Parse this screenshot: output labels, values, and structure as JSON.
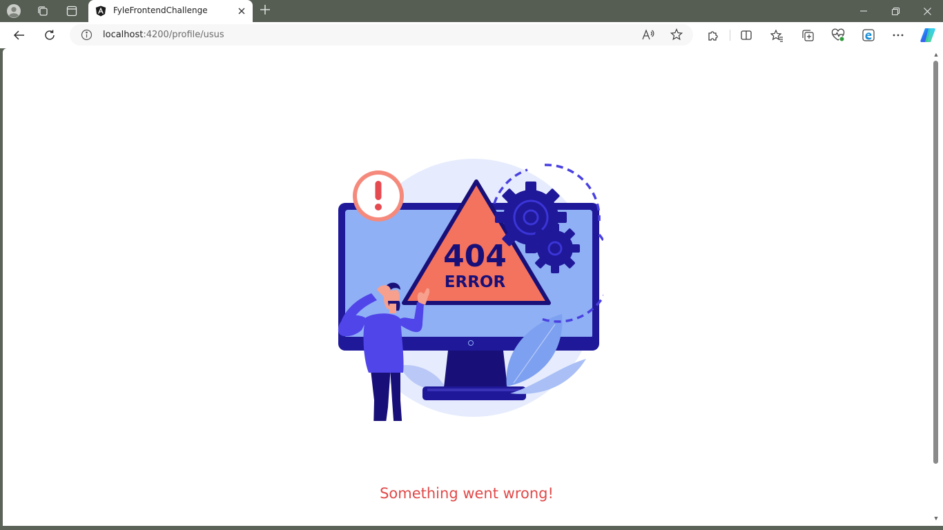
{
  "browser": {
    "tab": {
      "title": "FyleFrontendChallenge"
    },
    "address": {
      "host": "localhost",
      "path": ":4200/profile/usus"
    }
  },
  "page": {
    "illustration": {
      "code": "404",
      "label": "ERROR"
    },
    "message": "Something went wrong!"
  },
  "colors": {
    "message": "#e04949",
    "warning_triangle": "#f4735f",
    "monitor_frame": "#1f1899",
    "monitor_screen": "#8fb0f5",
    "person_shirt": "#5045e8"
  },
  "icons": [
    "profile-icon",
    "workspaces-icon",
    "tab-actions-icon",
    "angular-favicon",
    "close-icon",
    "plus-icon",
    "minimize-icon",
    "restore-icon",
    "close-window-icon",
    "back-icon",
    "refresh-icon",
    "info-icon",
    "read-aloud-icon",
    "favorite-star-icon",
    "extensions-icon",
    "split-screen-icon",
    "favorites-icon",
    "collections-icon",
    "browser-essentials-icon",
    "edge-bar-icon",
    "more-icon",
    "copilot-icon"
  ]
}
